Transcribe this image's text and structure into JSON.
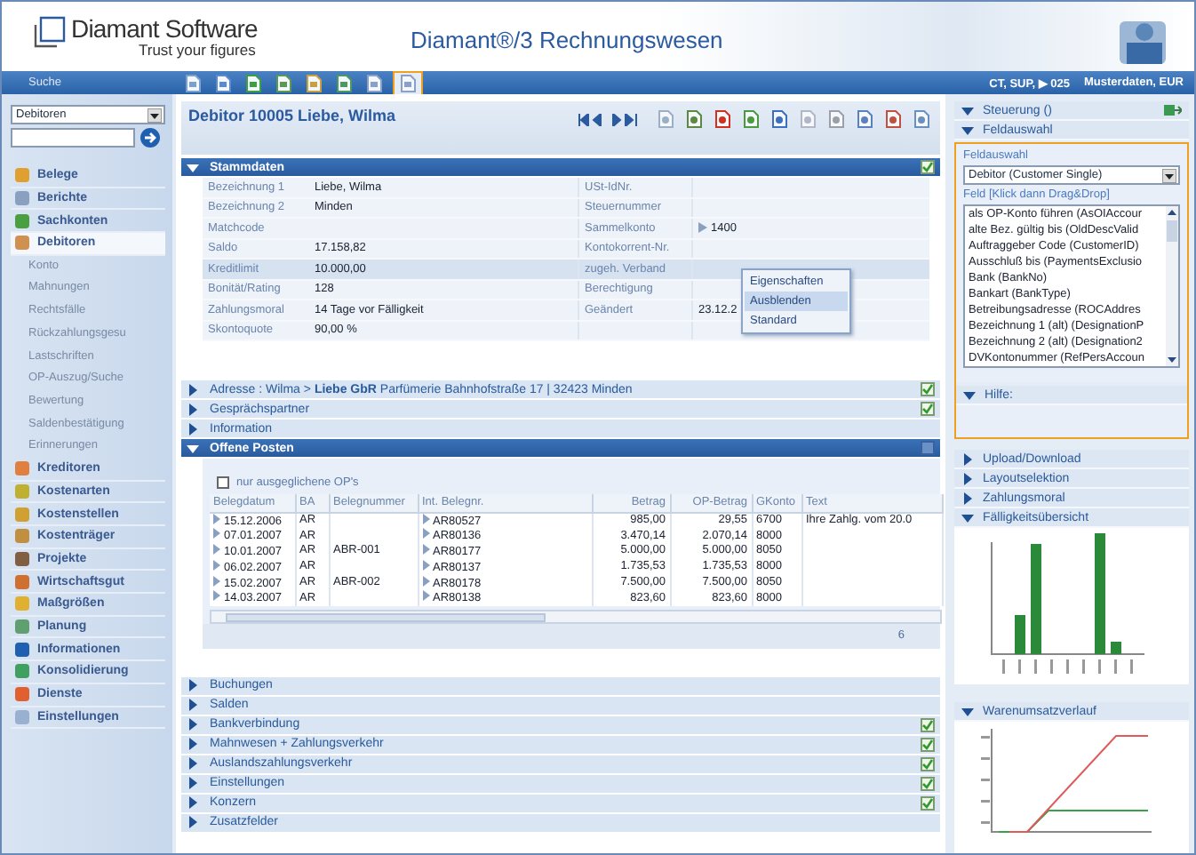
{
  "header": {
    "company": "Diamant Software",
    "slogan": "Trust your figures",
    "title": "Diamant®/3 Rechnungswesen"
  },
  "toolbar": {
    "search_label": "Suche",
    "icons": [
      {
        "highlighted": false
      },
      {
        "highlighted": false
      },
      {
        "highlighted": false
      },
      {
        "highlighted": false
      },
      {
        "highlighted": false
      },
      {
        "highlighted": false
      },
      {
        "highlighted": false
      },
      {
        "highlighted": true
      }
    ],
    "context": "CT, SUP, ▶ 025",
    "client": "Musterdaten, EUR"
  },
  "sidebar": {
    "search_scope": "Debitoren",
    "items": [
      {
        "label": "Belege",
        "selected": false
      },
      {
        "label": "Berichte",
        "selected": false
      },
      {
        "label": "Sachkonten",
        "selected": false
      },
      {
        "label": "Debitoren",
        "selected": true,
        "children": [
          {
            "label": "Konto"
          },
          {
            "label": "Mahnungen"
          },
          {
            "label": "Rechtsfälle"
          },
          {
            "label": "Rückzahlungsgesu"
          },
          {
            "label": "Lastschriften"
          },
          {
            "label": "OP-Auszug/Suche"
          },
          {
            "label": "Bewertung"
          },
          {
            "label": "Saldenbestätigung"
          },
          {
            "label": "Erinnerungen"
          }
        ]
      },
      {
        "label": "Kreditoren",
        "selected": false
      },
      {
        "label": "Kostenarten",
        "selected": false
      },
      {
        "label": "Kostenstellen",
        "selected": false
      },
      {
        "label": "Kostenträger",
        "selected": false
      },
      {
        "label": "Projekte",
        "selected": false
      },
      {
        "label": "Wirtschaftsgut",
        "selected": false
      },
      {
        "label": "Maßgrößen",
        "selected": false
      },
      {
        "label": "Planung",
        "selected": false
      },
      {
        "label": "Informationen",
        "selected": false
      },
      {
        "label": "Konsolidierung",
        "selected": false
      },
      {
        "label": "Dienste",
        "selected": false
      },
      {
        "label": "Einstellungen",
        "selected": false
      }
    ]
  },
  "record": {
    "title": "Debitor 10005 Liebe, Wilma",
    "stammdaten": {
      "title": "Stammdaten",
      "expanded": true,
      "rows": [
        {
          "label": "Bezeichnung 1",
          "value": "Liebe, Wilma",
          "label_2": "USt-IdNr.",
          "selected": false
        },
        {
          "label": "Bezeichnung 2",
          "value": "Minden",
          "label_2": "Steuernummer",
          "selected": false
        },
        {
          "label": "Matchcode",
          "label_2": "Sammelkonto",
          "value_2": "1400",
          "selected": false
        },
        {
          "label": "Saldo",
          "value": "17.158,82",
          "label_2": "Kontokorrent-Nr.",
          "selected": false
        },
        {
          "label": "Kreditlimit",
          "value": "10.000,00",
          "label_2": "zugeh. Verband",
          "selected": true
        },
        {
          "label": "Bonität/Rating",
          "value": "128",
          "label_2": "Berechtigung",
          "selected": false
        },
        {
          "label": "Zahlungsmoral",
          "value": "14 Tage vor Fälligkeit",
          "label_2": "Geändert",
          "value_2": "23.12.2",
          "selected": false
        },
        {
          "label": "Skontoquote",
          "value": "90,00  %",
          "selected": false
        }
      ]
    },
    "context_menu": [
      {
        "label": "Eigenschaften",
        "selected": false
      },
      {
        "label": "Ausblenden",
        "selected": true
      },
      {
        "label": "Standard",
        "selected": false
      }
    ],
    "sections_top": [
      {
        "title": "Adresse : Wilma > **Liebe GbR** Parfümerie Bahnhofstraße 17 | 32423 Minden",
        "expanded": false,
        "editable": true
      },
      {
        "title": "Gesprächspartner",
        "expanded": false,
        "editable": true
      },
      {
        "title": "Information",
        "expanded": false,
        "editable": false
      }
    ],
    "open_items": {
      "title": "Offene Posten",
      "expanded": true,
      "filter": {
        "label": "nur ausgeglichene OP's",
        "checked": false
      },
      "columns": [
        "Belegdatum",
        "BA",
        "Belegnummer",
        "Int. Belegnr.",
        "Betrag",
        "OP-Betrag",
        "GKonto",
        "Text"
      ],
      "rows": [
        [
          "15.12.2006",
          "AR",
          "",
          "AR80527",
          "985,00",
          "29,55",
          "6700",
          "Ihre Zahlg. vom 20.0"
        ],
        [
          "07.01.2007",
          "AR",
          "",
          "AR80136",
          "3.470,14",
          "2.070,14",
          "8000",
          ""
        ],
        [
          "10.01.2007",
          "AR",
          "ABR-001",
          "AR80177",
          "5.000,00",
          "5.000,00",
          "8050",
          ""
        ],
        [
          "06.02.2007",
          "AR",
          "",
          "AR80137",
          "1.735,53",
          "1.735,53",
          "8000",
          ""
        ],
        [
          "15.02.2007",
          "AR",
          "ABR-002",
          "AR80178",
          "7.500,00",
          "7.500,00",
          "8050",
          ""
        ],
        [
          "14.03.2007",
          "AR",
          "",
          "AR80138",
          "823,60",
          "823,60",
          "8000",
          ""
        ]
      ],
      "count": "6"
    },
    "sections_bottom": [
      {
        "title": "Buchungen",
        "expanded": false,
        "editable": false
      },
      {
        "title": "Salden",
        "expanded": false,
        "editable": false
      },
      {
        "title": "Bankverbindung",
        "expanded": false,
        "editable": true
      },
      {
        "title": "Mahnwesen + Zahlungsverkehr",
        "expanded": false,
        "editable": true
      },
      {
        "title": "Auslandszahlungsverkehr",
        "expanded": false,
        "editable": true
      },
      {
        "title": "Einstellungen",
        "expanded": false,
        "editable": true
      },
      {
        "title": "Konzern",
        "expanded": false,
        "editable": true
      },
      {
        "title": "Zusatzfelder",
        "expanded": false,
        "editable": false
      }
    ]
  },
  "side_panel": {
    "steuerung": {
      "title": "Steuerung ()",
      "expanded": true
    },
    "feldauswahl": {
      "title": "Feldauswahl",
      "expanded": true,
      "highlighted": true,
      "select_label": "Feldauswahl",
      "select_value": "Debitor (Customer Single)",
      "list_label": "Feld [Klick dann Drag&Drop]",
      "fields": [
        "als OP-Konto führen (AsOIAccour",
        "alte Bez. gültig bis (OldDescValid",
        "Auftraggeber Code (CustomerID)",
        "Ausschluß bis (PaymentsExclusio",
        "Bank (BankNo)",
        "Bankart (BankType)",
        "Betreibungsadresse (ROCAddres",
        "Bezeichnung 1 (alt) (DesignationP",
        "Bezeichnung 2 (alt) (Designation2",
        "DVKontonummer (RefPersAccoun"
      ],
      "help_title": "Hilfe:"
    },
    "sections": [
      {
        "title": "Upload/Download",
        "expanded": false
      },
      {
        "title": "Layoutselektion",
        "expanded": false
      },
      {
        "title": "Zahlungsmoral",
        "expanded": false
      },
      {
        "title": "Fälligkeitsübersicht",
        "expanded": true,
        "kind": "bar-chart"
      },
      {
        "title": "Warenumsatzverlauf",
        "expanded": true,
        "kind": "line-chart"
      }
    ]
  }
}
